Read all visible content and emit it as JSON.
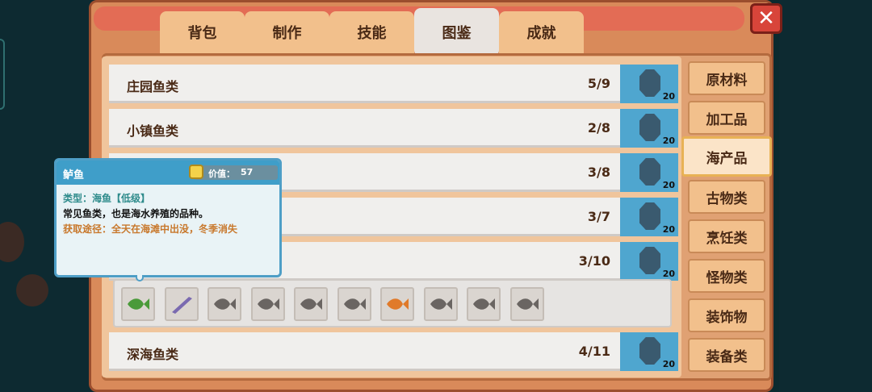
{
  "tabs": [
    {
      "label": "背包"
    },
    {
      "label": "制作"
    },
    {
      "label": "技能"
    },
    {
      "label": "图鉴",
      "active": true
    },
    {
      "label": "成就"
    }
  ],
  "close_icon": "close-x-icon",
  "categories": [
    {
      "label": "原材料"
    },
    {
      "label": "加工品"
    },
    {
      "label": "海产品",
      "active": true
    },
    {
      "label": "古物类"
    },
    {
      "label": "烹饪类"
    },
    {
      "label": "怪物类"
    },
    {
      "label": "装饰物"
    },
    {
      "label": "装备类"
    }
  ],
  "rows": [
    {
      "label": "庄园鱼类",
      "count": "5/9",
      "badge": "20"
    },
    {
      "label": "小镇鱼类",
      "count": "2/8",
      "badge": "20"
    },
    {
      "label": "",
      "count": "3/8",
      "badge": "20"
    },
    {
      "label": "",
      "count": "3/7",
      "badge": "20"
    },
    {
      "label": "",
      "count": "3/10",
      "badge": "20"
    },
    {
      "label": "深海鱼类",
      "count": "4/11",
      "badge": "20"
    }
  ],
  "fish_slots": [
    {
      "icon": "green-fish-icon",
      "color": "#4a9a3a",
      "discovered": true
    },
    {
      "icon": "purple-eel-icon",
      "color": "#7a6ab0",
      "discovered": true
    },
    {
      "icon": "fish-silhouette-icon",
      "color": "#6a6562",
      "discovered": false
    },
    {
      "icon": "fish-silhouette-icon",
      "color": "#6a6562",
      "discovered": false
    },
    {
      "icon": "fish-silhouette-icon",
      "color": "#6a6562",
      "discovered": false
    },
    {
      "icon": "fish-silhouette-icon",
      "color": "#6a6562",
      "discovered": false
    },
    {
      "icon": "orange-fish-icon",
      "color": "#e07a2a",
      "discovered": true
    },
    {
      "icon": "fish-silhouette-icon",
      "color": "#6a6562",
      "discovered": false
    },
    {
      "icon": "fish-silhouette-icon",
      "color": "#6a6562",
      "discovered": false
    },
    {
      "icon": "fish-silhouette-icon",
      "color": "#6a6562",
      "discovered": false
    }
  ],
  "tooltip": {
    "name": "鲈鱼",
    "value_label": "价值：",
    "value": "57",
    "type_line": "类型：海鱼【低级】",
    "desc_line": "常见鱼类，也是海水养殖的品种。",
    "source_line": "获取途径：全天在海滩中出没，冬季消失"
  },
  "colors": {
    "panel": "#d98a5a",
    "tab": "#f2c08c",
    "tab_active": "#e9e4e0",
    "row_icon_bg": "#4fa6cf",
    "tooltip_header": "#3f9ec9",
    "close_button": "#d8453a"
  }
}
